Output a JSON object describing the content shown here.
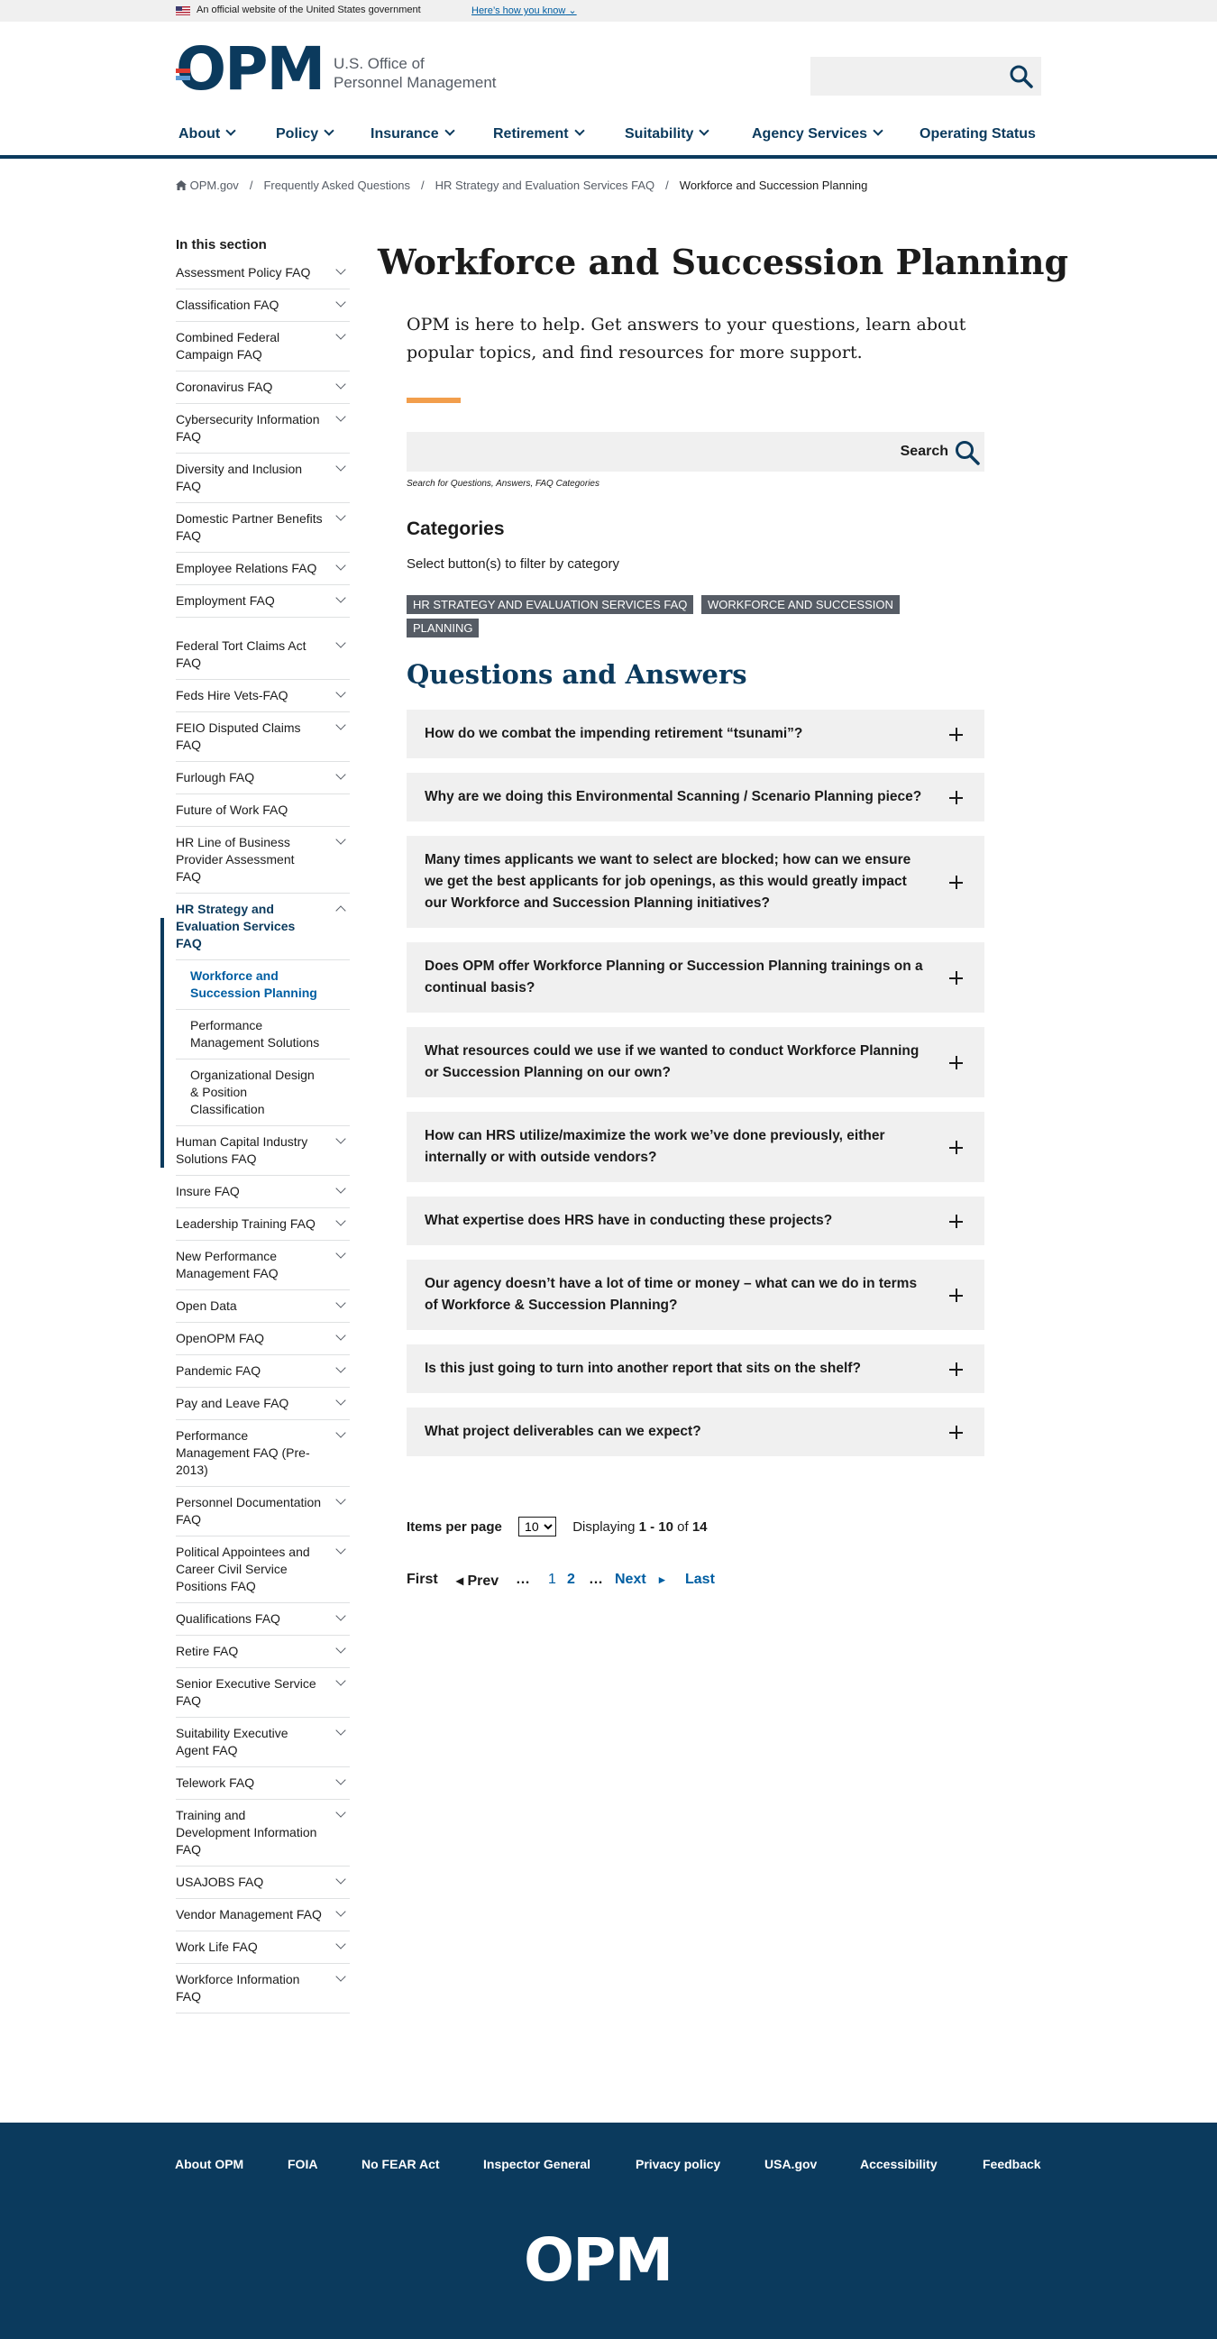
{
  "banner": {
    "text": "An official website of the United States government",
    "how": "Here’s how you know"
  },
  "logo": {
    "word": "OPM",
    "agency_line1": "U.S. Office of",
    "agency_line2": "Personnel Management"
  },
  "nav": [
    "About",
    "Policy",
    "Insurance",
    "Retirement",
    "Suitability",
    "Agency Services",
    "Operating Status"
  ],
  "breadcrumb": {
    "home": "OPM.gov",
    "c1": "Frequently Asked Questions",
    "c2": "HR Strategy and Evaluation Services FAQ",
    "current": "Workforce and Succession Planning"
  },
  "sidenav": {
    "heading": "In this section",
    "items": [
      "Assessment Policy FAQ",
      "Classification FAQ",
      "Combined Federal Campaign FAQ",
      "Coronavirus FAQ",
      "Cybersecurity Information FAQ",
      "Diversity and Inclusion FAQ",
      "Domestic Partner Benefits FAQ",
      "Employee Relations FAQ",
      "Employment FAQ",
      "Federal Tort Claims Act FAQ",
      "Feds Hire Vets-FAQ",
      "FEIO Disputed Claims FAQ",
      "Furlough FAQ",
      "Future of Work FAQ",
      "HR Line of Business Provider Assessment FAQ",
      "HR Strategy and Evaluation Services FAQ",
      "Workforce and Succession Planning",
      "Performance Management Solutions",
      "Organizational Design & Position Classification",
      "Human Capital Industry Solutions FAQ",
      "Insure FAQ",
      "Leadership Training FAQ",
      "New Performance Management FAQ",
      "Open Data",
      "OpenOPM FAQ",
      "Pandemic FAQ",
      "Pay and Leave FAQ",
      "Performance Management FAQ (Pre-2013)",
      "Personnel Documentation FAQ",
      "Political Appointees and Career Civil Service Positions FAQ",
      "Qualifications FAQ",
      "Retire FAQ",
      "Senior Executive Service FAQ",
      "Suitability Executive Agent FAQ",
      "Telework FAQ",
      "Training and Development Information FAQ",
      "USAJOBS FAQ",
      "Vendor Management FAQ",
      "Work Life FAQ",
      "Workforce Information FAQ"
    ]
  },
  "main": {
    "title": "Workforce and Succession Planning",
    "intro": "OPM is here to help. Get answers to your questions, learn about popular topics, and find resources for more support.",
    "search_label": "Search",
    "search_help": "Search for Questions, Answers, FAQ Categories",
    "categories_heading": "Categories",
    "categories_sub": "Select button(s) to filter by category",
    "tags": [
      "HR STRATEGY AND EVALUATION SERVICES FAQ",
      "WORKFORCE AND SUCCESSION PLANNING"
    ],
    "qa_heading": "Questions and Answers",
    "questions": [
      "How do we combat the impending retirement “tsunami”?",
      "Why are we doing this Environmental Scanning / Scenario Planning piece?",
      "Many times applicants we want to select are blocked; how can we ensure we get the best applicants for job openings, as this would greatly impact our Workforce and Succession Planning initiatives?",
      "Does OPM offer Workforce Planning or Succession Planning trainings on a continual basis?",
      "What resources could we use if we wanted to conduct Workforce Planning or Succession Planning on our own?",
      "How can HRS utilize/maximize the work we’ve done previously, either internally or with outside vendors?",
      "What expertise does HRS have in conducting these projects?",
      "Our agency doesn’t have a lot of time or money – what can we do in terms of Workforce & Succession Planning?",
      "Is this just going to turn into another report that sits on the shelf?",
      "What project deliverables can we expect?"
    ],
    "items_per_page_label": "Items per page",
    "items_per_page_value": "10",
    "displaying": "Displaying",
    "range": "1 - 10",
    "of": "of",
    "total": "14",
    "pager": {
      "first": "First",
      "prev": "◂ Prev",
      "ellipsis": "…",
      "p1": "1",
      "p2": "2",
      "next": "Next",
      "next_arrow": "▸",
      "last": "Last"
    }
  },
  "footer": {
    "links": [
      "About OPM",
      "FOIA",
      "No FEAR Act",
      "Inspector General",
      "Privacy policy",
      "USA.gov",
      "Accessibility",
      "Feedback"
    ],
    "logo": "OPM"
  },
  "colors": {
    "navy": "#0b3a5d",
    "link": "#005ea2",
    "accent_orange": "#f29e4c",
    "tag_bg": "#565c65",
    "panel": "#f0f0f0"
  }
}
